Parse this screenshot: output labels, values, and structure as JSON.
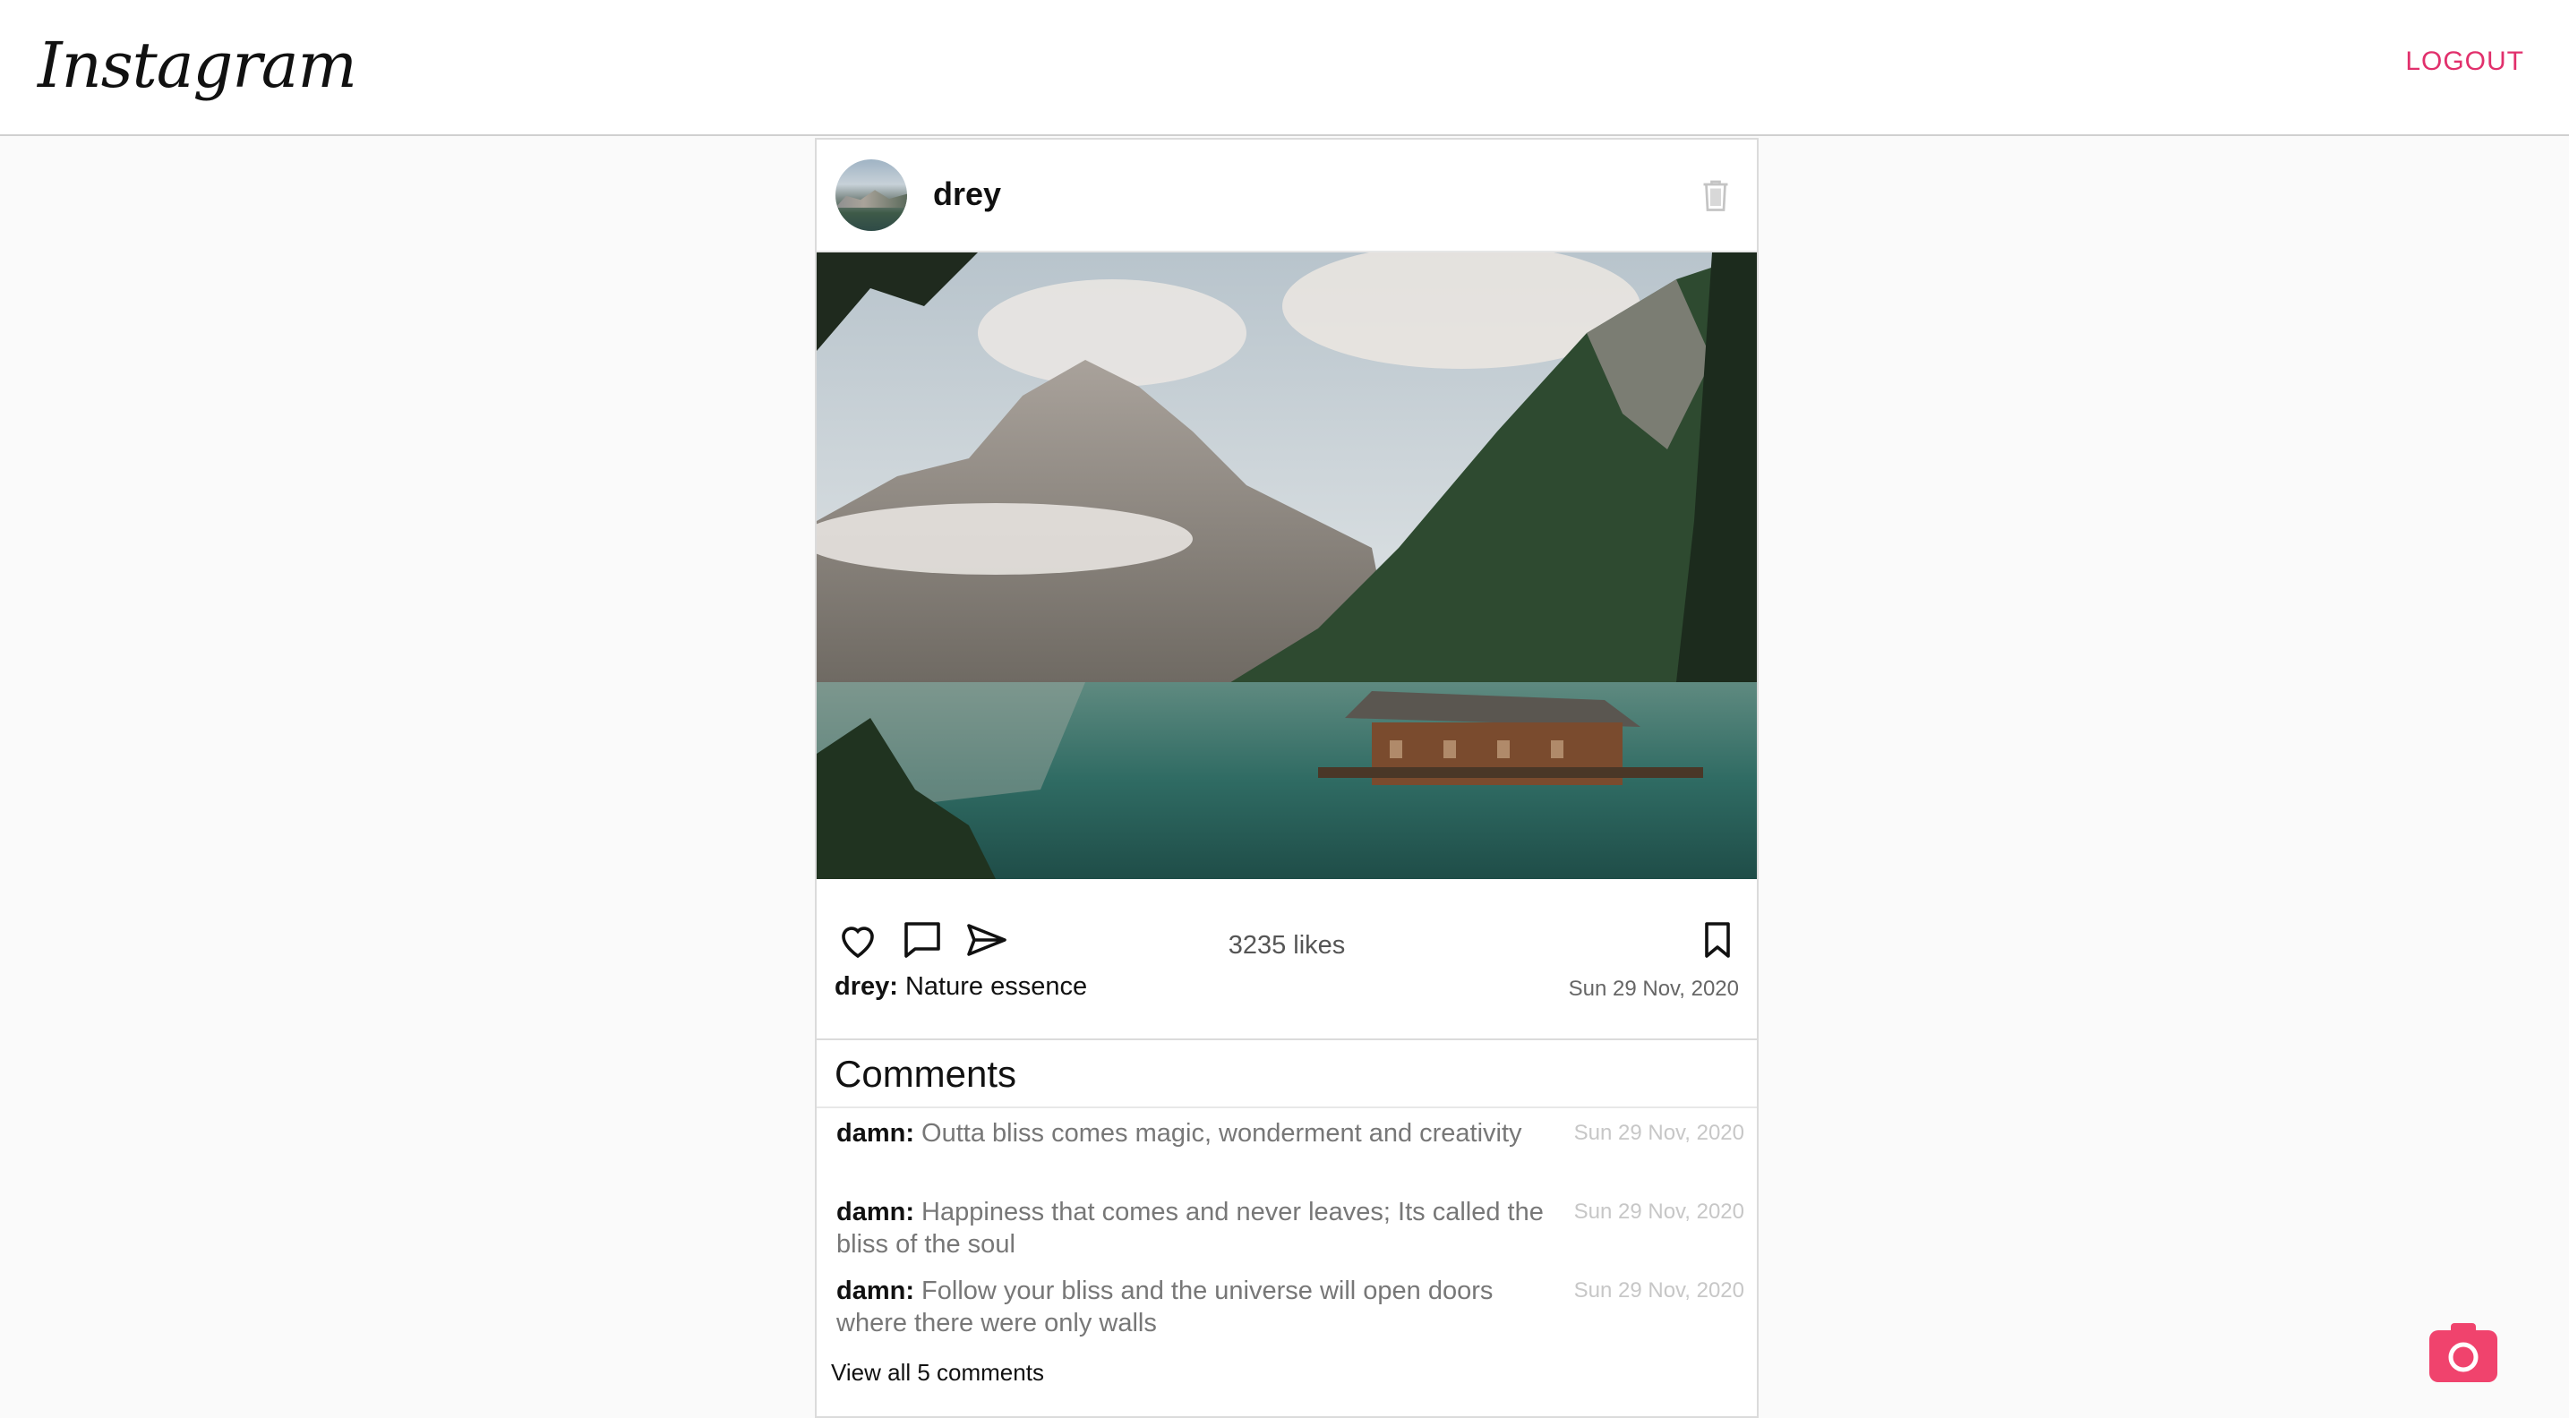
{
  "header": {
    "logo": "Instagram",
    "logout_label": "LOGOUT"
  },
  "post": {
    "username": "drey",
    "likes": "3235 likes",
    "caption": {
      "user": "drey:",
      "text": " Nature essence",
      "date": "Sun 29 Nov, 2020"
    }
  },
  "comments": {
    "title": "Comments",
    "items": [
      {
        "user": "damn:",
        "text": " Outta bliss comes magic, wonderment and creativity",
        "date": "Sun 29 Nov, 2020"
      },
      {
        "user": "damn:",
        "text": " Happiness that comes and never leaves; Its called the bliss of the soul",
        "date": "Sun 29 Nov, 2020"
      },
      {
        "user": "damn:",
        "text": " Follow your bliss and the universe will open doors where there were only walls",
        "date": "Sun 29 Nov, 2020"
      }
    ],
    "view_all": "View all 5 comments"
  },
  "icons": {
    "delete": "trash-icon",
    "like": "heart-icon",
    "comment": "comment-icon",
    "share": "send-icon",
    "save": "bookmark-icon",
    "upload": "camera-icon"
  },
  "colors": {
    "accent": "#e1306c",
    "camera_button": "#f0436d"
  }
}
